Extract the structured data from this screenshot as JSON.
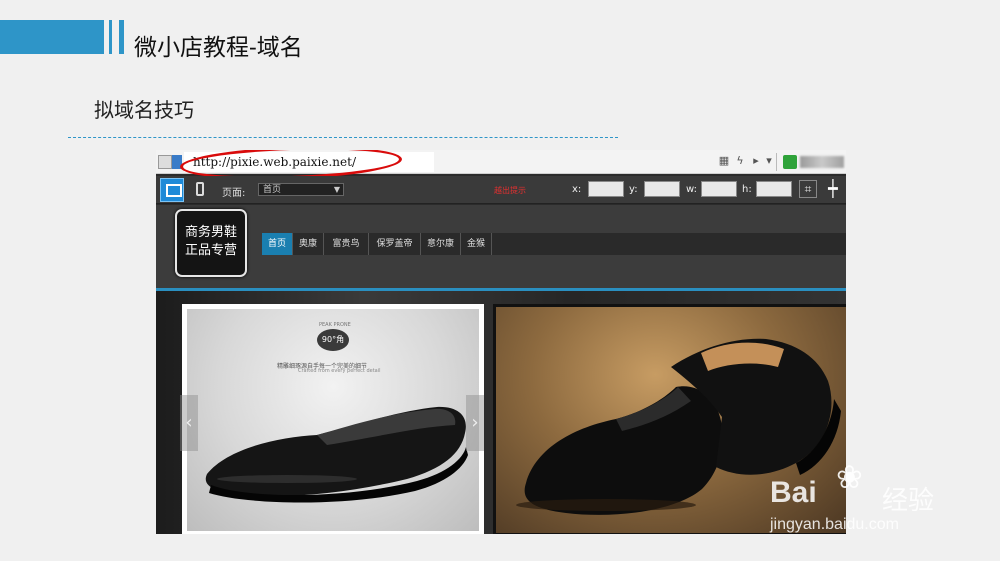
{
  "slide": {
    "title": "微小店教程-域名",
    "subtitle": "拟域名技巧",
    "accent_color": "#2e95c8"
  },
  "browser": {
    "url": "http://pixie.web.paixie.net/",
    "highlight_color": "#d90b0b"
  },
  "editor": {
    "page_label": "页面:",
    "page_select": "首页",
    "warning": "越出提示",
    "coord_labels": [
      "x:",
      "y:",
      "w:",
      "h:"
    ]
  },
  "site": {
    "logo_line1": "商务男鞋",
    "logo_line2": "正品专营",
    "nav": [
      "首页",
      "奥康",
      "富贵鸟",
      "保罗盖帝",
      "意尔康",
      "金猴"
    ],
    "active_nav": "首页"
  },
  "banner": {
    "badge": "90°角",
    "badge_top": "PEAK PRONE",
    "tagline": "精雕细琢源自手每一个完美的细节",
    "tagline_en": "Crafted from every perfect detail"
  },
  "watermark": {
    "brand": "Bai",
    "brand_cn": "经验",
    "url": "jingyan.baidu.com"
  }
}
